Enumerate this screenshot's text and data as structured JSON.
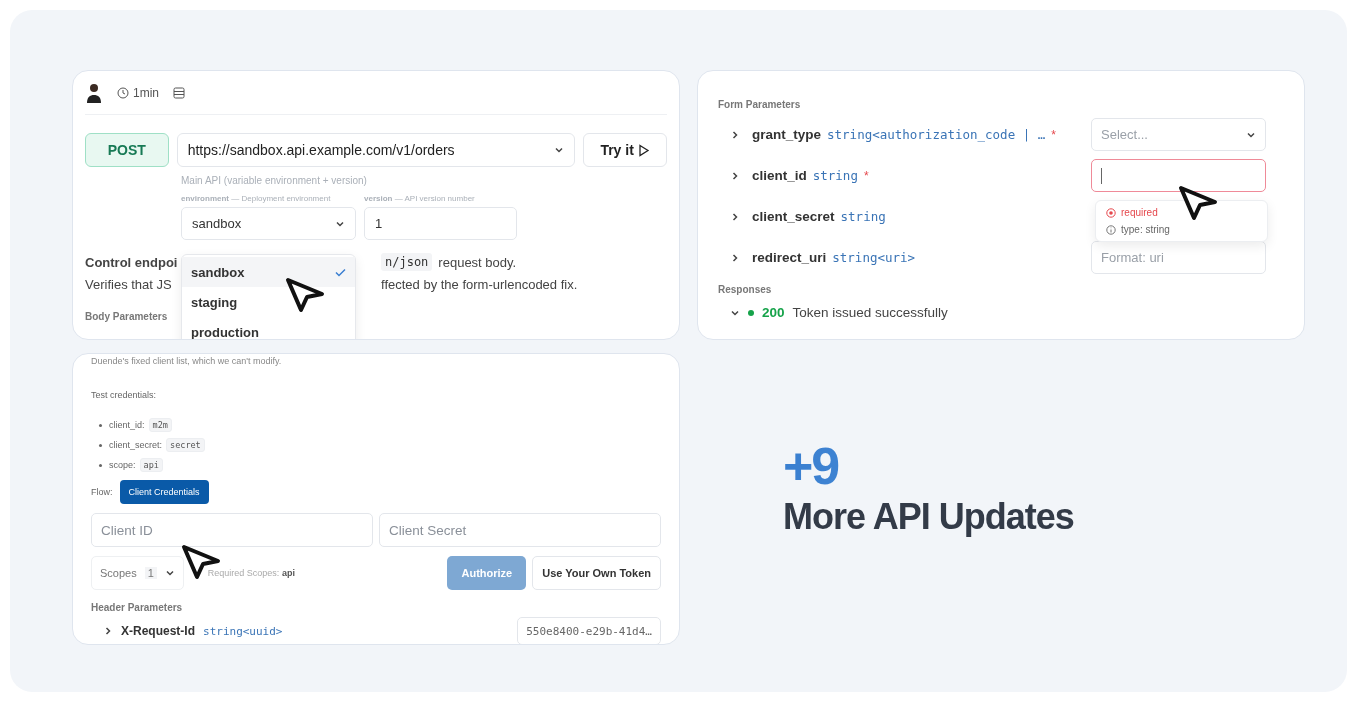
{
  "request_panel": {
    "read_time": "1min",
    "method": "POST",
    "url": "https://sandbox.api.example.com/v1/orders",
    "try_button": "Try it",
    "server_note": "Main API (variable environment + version)",
    "variables": [
      {
        "kind": "select",
        "name": "environment",
        "description": "— Deployment environment",
        "value": "sandbox"
      },
      {
        "kind": "text",
        "name": "version",
        "description": "— API version number",
        "value": "1"
      }
    ],
    "dropdown": [
      {
        "label": "sandbox",
        "selected": true
      },
      {
        "label": "staging",
        "selected": false
      },
      {
        "label": "production",
        "selected": false
      }
    ],
    "description_line_1": {
      "lead": "Control endpoi",
      "code": "n/json",
      "tail": "request body."
    },
    "description_line_2": {
      "lead": "Verifies that JS",
      "tail": "ffected by the form-urlencoded fix."
    },
    "section_label": "Body Parameters"
  },
  "form_panel": {
    "section_label": "Form Parameters",
    "params": [
      {
        "name": "grant_type",
        "type": "string<authorization_code | …",
        "required_marker": "*",
        "input": {
          "kind": "select",
          "placeholder": "Select..."
        }
      },
      {
        "name": "client_id",
        "type": "string",
        "required_marker": "*",
        "input": {
          "kind": "text",
          "invalid": true
        }
      },
      {
        "name": "client_secret",
        "type": "string"
      },
      {
        "name": "redirect_uri",
        "type": "string<uri>",
        "input": {
          "kind": "text",
          "invalid": false,
          "placeholder": "Format: uri"
        }
      }
    ],
    "validation": [
      {
        "kind": "error",
        "text": "required"
      },
      {
        "kind": "info",
        "text": "type: string"
      }
    ],
    "responses_label": "Responses",
    "responses": [
      {
        "code": "200",
        "text": "Token issued successfully",
        "expanded": true,
        "color": "#16a34a"
      }
    ]
  },
  "auth_panel": {
    "note": "Duende's fixed client list, which we can't modify.",
    "credentials_label": "Test credentials:",
    "credentials": [
      {
        "label": "client_id:",
        "value": "m2m"
      },
      {
        "label": "client_secret:",
        "value": "secret"
      },
      {
        "label": "scope:",
        "value": "api"
      }
    ],
    "flow_label": "Flow:",
    "flow_button": "Client Credentials",
    "fields": [
      {
        "placeholder": "Client ID"
      },
      {
        "placeholder": "Client Secret"
      }
    ],
    "scopes": {
      "label": "Scopes",
      "count": "1"
    },
    "required_scopes_label": "Required Scopes:",
    "required_scopes_value": "api",
    "buttons": [
      {
        "label": "Authorize",
        "disabled": true
      },
      {
        "label": "Use Your Own Token",
        "disabled": false
      }
    ],
    "header_label": "Header Parameters",
    "header_param": {
      "name": "X-Request-Id",
      "type": "string<uuid>",
      "value": "550e8400-e29b-41d4…"
    }
  },
  "promo": {
    "count": "+9",
    "title": "More API Updates"
  }
}
